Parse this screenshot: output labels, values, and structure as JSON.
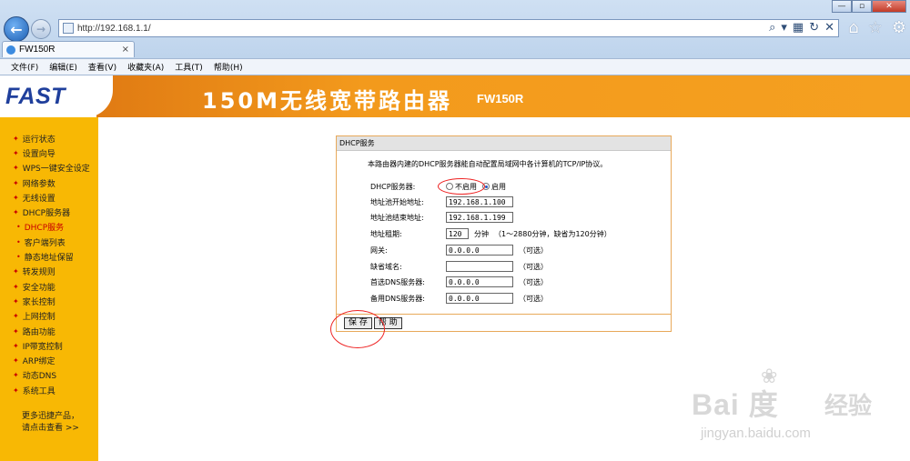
{
  "browser": {
    "url": "http://192.168.1.1/",
    "tab_title": "FW150R",
    "tab_close": "×",
    "menu": [
      "文件(F)",
      "编辑(E)",
      "查看(V)",
      "收藏夹(A)",
      "工具(T)",
      "帮助(H)"
    ],
    "window_controls": [
      "—",
      "▫",
      "✕"
    ]
  },
  "banner": {
    "logo": "FAST",
    "title": "150M无线宽带路由器",
    "model": "FW150R"
  },
  "sidebar": {
    "items": [
      {
        "label": "运行状态",
        "sub": false,
        "active": false
      },
      {
        "label": "设置向导",
        "sub": false,
        "active": false
      },
      {
        "label": "WPS一键安全设定",
        "sub": false,
        "active": false
      },
      {
        "label": "网络参数",
        "sub": false,
        "active": false
      },
      {
        "label": "无线设置",
        "sub": false,
        "active": false
      },
      {
        "label": "DHCP服务器",
        "sub": false,
        "active": false
      },
      {
        "label": "DHCP服务",
        "sub": true,
        "active": true
      },
      {
        "label": "客户端列表",
        "sub": true,
        "active": false
      },
      {
        "label": "静态地址保留",
        "sub": true,
        "active": false
      },
      {
        "label": "转发规则",
        "sub": false,
        "active": false
      },
      {
        "label": "安全功能",
        "sub": false,
        "active": false
      },
      {
        "label": "家长控制",
        "sub": false,
        "active": false
      },
      {
        "label": "上网控制",
        "sub": false,
        "active": false
      },
      {
        "label": "路由功能",
        "sub": false,
        "active": false
      },
      {
        "label": "IP带宽控制",
        "sub": false,
        "active": false
      },
      {
        "label": "ARP绑定",
        "sub": false,
        "active": false
      },
      {
        "label": "动态DNS",
        "sub": false,
        "active": false
      },
      {
        "label": "系统工具",
        "sub": false,
        "active": false
      }
    ],
    "more_line1": "更多迅捷产品，",
    "more_line2": "请点击查看 >>"
  },
  "form": {
    "title": "DHCP服务",
    "description": "本路由器内建的DHCP服务器能自动配置局域网中各计算机的TCP/IP协议。",
    "dhcp_label": "DHCP服务器:",
    "dhcp_off": "不启用",
    "dhcp_on": "启用",
    "dhcp_enabled": true,
    "start_label": "地址池开始地址:",
    "start_value": "192.168.1.100",
    "end_label": "地址池结束地址:",
    "end_value": "192.168.1.199",
    "lease_label": "地址租期:",
    "lease_value": "120",
    "lease_unit": "分钟",
    "lease_hint": "（1～2880分钟，缺省为120分钟）",
    "gateway_label": "网关:",
    "gateway_value": "0.0.0.0",
    "domain_label": "缺省域名:",
    "domain_value": "",
    "dns1_label": "首选DNS服务器:",
    "dns1_value": "0.0.0.0",
    "dns2_label": "备用DNS服务器:",
    "dns2_value": "0.0.0.0",
    "optional": "（可选）",
    "save_label": "保 存",
    "help_label": "帮 助"
  },
  "watermark": {
    "brand": "Bai 度",
    "cn": "经验",
    "site": "jingyan.baidu.com"
  },
  "colors": {
    "banner_orange": "#f39a1c",
    "sidebar_yellow": "#f8b804",
    "logo_blue": "#1f3f9c",
    "active_red": "#c80000",
    "annotation_red": "#e22222"
  }
}
